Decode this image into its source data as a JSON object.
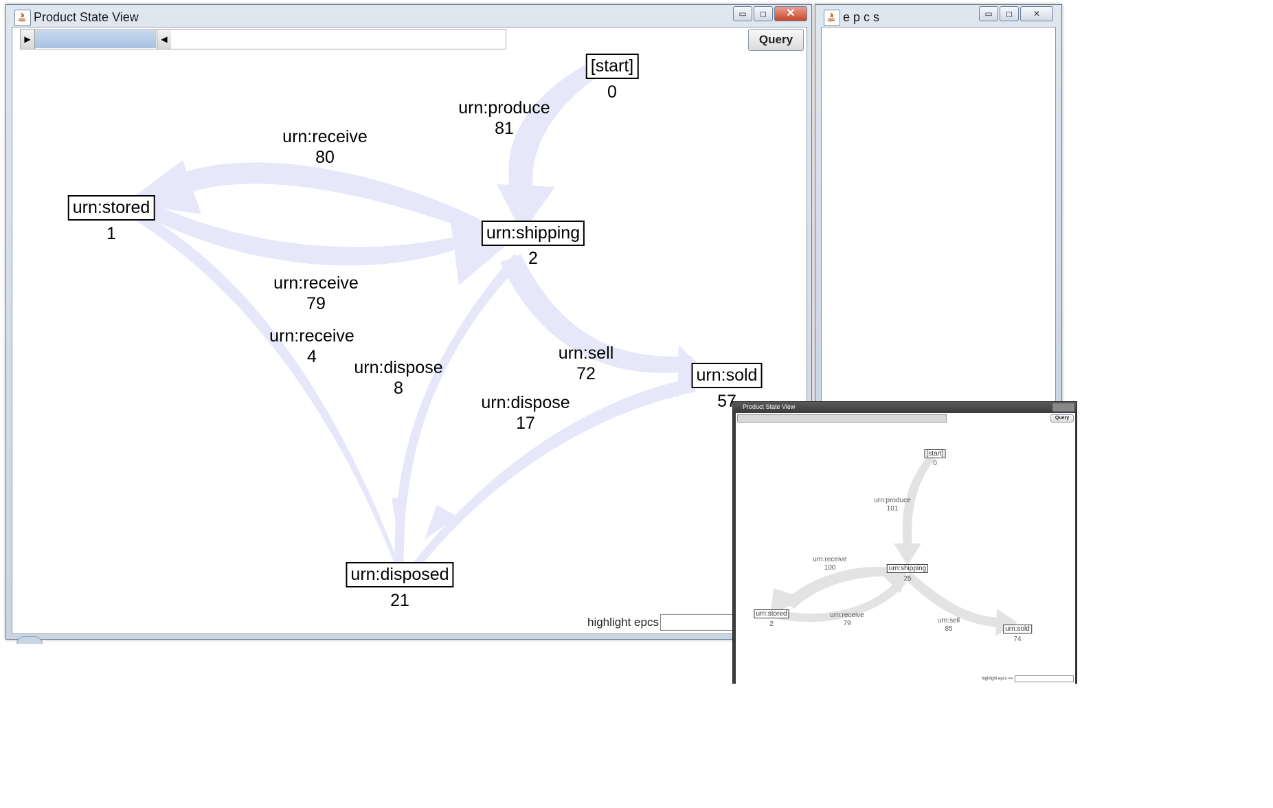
{
  "main_window": {
    "title": "Product State View",
    "query_label": "Query",
    "highlight_label": "highlight epcs >>",
    "nodes": [
      {
        "label": "[start]",
        "count": "0"
      },
      {
        "label": "urn:stored",
        "count": "1"
      },
      {
        "label": "urn:shipping",
        "count": "2"
      },
      {
        "label": "urn:sold",
        "count": "57"
      },
      {
        "label": "urn:disposed",
        "count": "21"
      }
    ],
    "edges": [
      {
        "label": "urn:produce",
        "count": "81"
      },
      {
        "label": "urn:receive",
        "count": "80"
      },
      {
        "label": "urn:receive",
        "count": "79"
      },
      {
        "label": "urn:receive",
        "count": "4"
      },
      {
        "label": "urn:dispose",
        "count": "8"
      },
      {
        "label": "urn:sell",
        "count": "72"
      },
      {
        "label": "urn:dispose",
        "count": "17"
      }
    ],
    "edge_color": "#e6e8fa"
  },
  "epcs_window": {
    "title": "e p c s"
  },
  "inset_window": {
    "title": "Product State View",
    "query_label": "Query",
    "highlight_label": "highlight epcs >>",
    "nodes": [
      {
        "label": "[start]",
        "count": "0"
      },
      {
        "label": "urn:shipping",
        "count": "25"
      },
      {
        "label": "urn:stored",
        "count": "2"
      },
      {
        "label": "urn:sold",
        "count": "74"
      }
    ],
    "edges": [
      {
        "label": "urn:produce",
        "count": "101"
      },
      {
        "label": "urn:receive",
        "count": "100"
      },
      {
        "label": "urn:receive",
        "count": "79"
      },
      {
        "label": "urn:sell",
        "count": "85"
      }
    ],
    "edge_color": "#e3e3e3"
  }
}
